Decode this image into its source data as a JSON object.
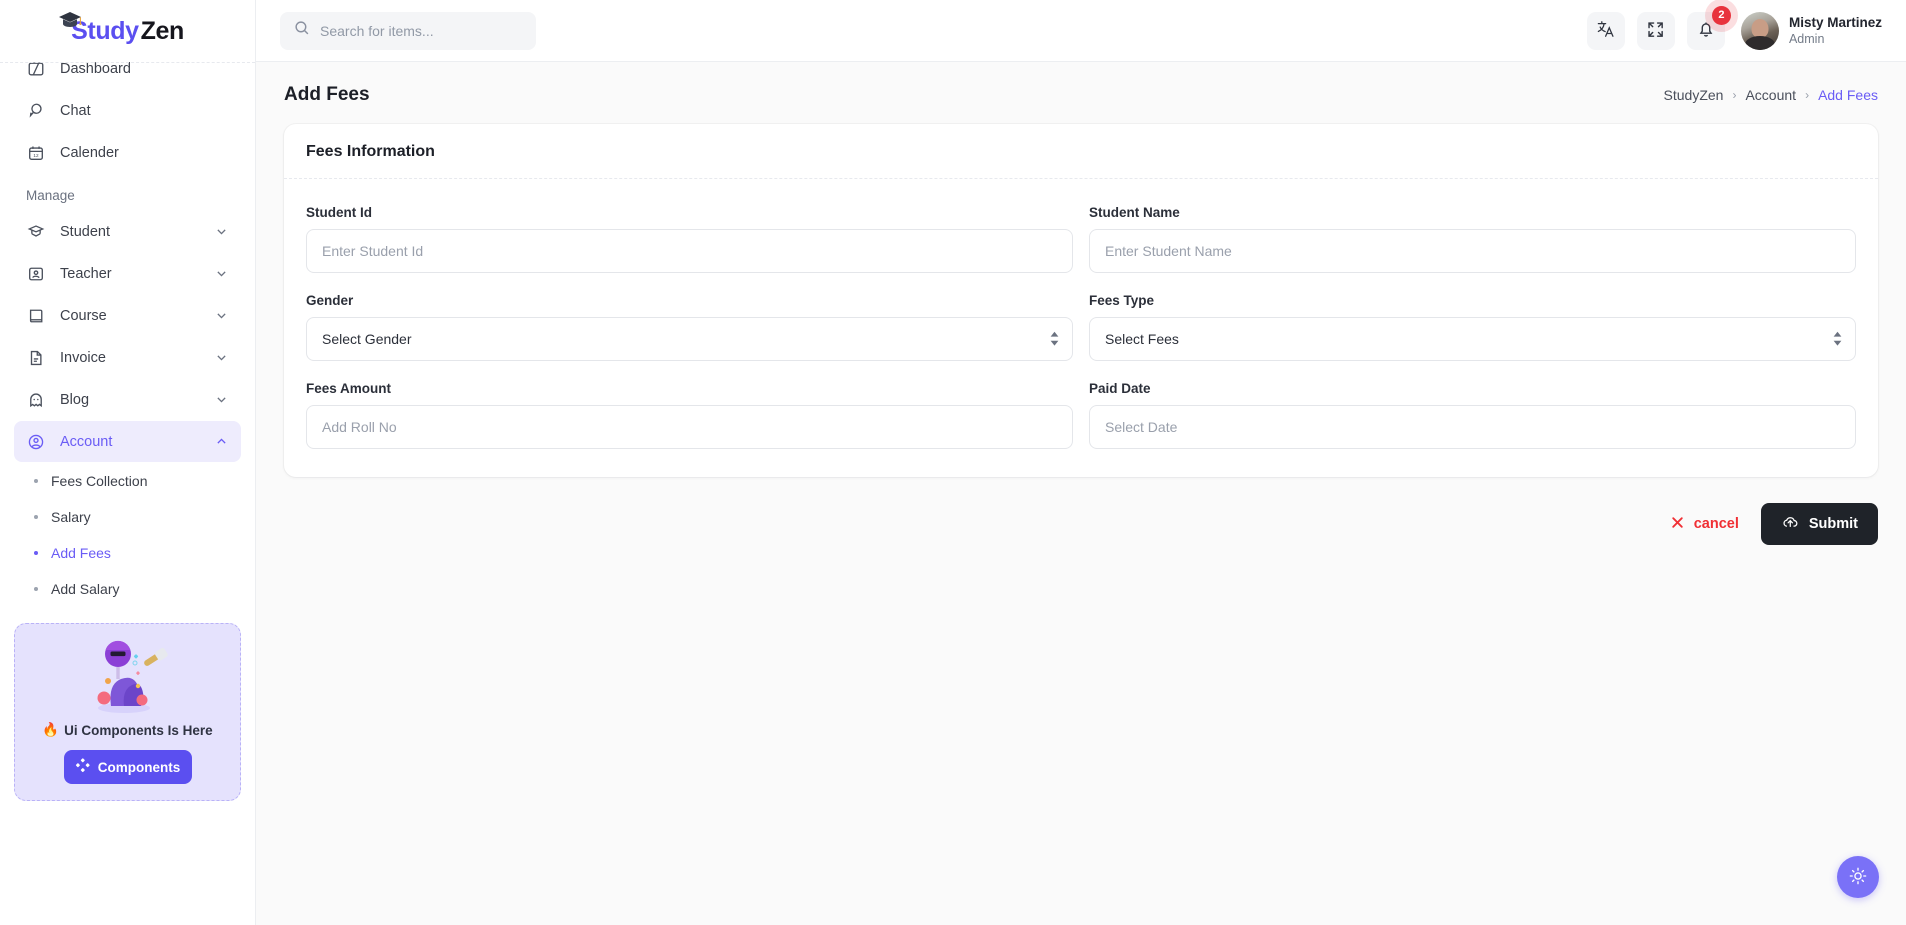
{
  "brand": {
    "part1": "Study",
    "part2": "Zen",
    "cap_icon": "graduation-cap-icon"
  },
  "sidebar": {
    "top_items": [
      {
        "label": "Dashboard",
        "icon": "dashboard-icon"
      },
      {
        "label": "Chat",
        "icon": "chat-icon"
      },
      {
        "label": "Calender",
        "icon": "calendar-icon"
      }
    ],
    "section_label": "Manage",
    "manage_items": [
      {
        "label": "Student",
        "icon": "student-cap-icon",
        "expanded": false
      },
      {
        "label": "Teacher",
        "icon": "teacher-icon",
        "expanded": false
      },
      {
        "label": "Course",
        "icon": "book-icon",
        "expanded": false
      },
      {
        "label": "Invoice",
        "icon": "invoice-file-icon",
        "expanded": false
      },
      {
        "label": "Blog",
        "icon": "ghost-icon",
        "expanded": false
      },
      {
        "label": "Account",
        "icon": "account-circle-icon",
        "expanded": true,
        "active": true
      }
    ],
    "sub_items": [
      {
        "label": "Fees Collection",
        "active": false
      },
      {
        "label": "Salary",
        "active": false
      },
      {
        "label": "Add Fees",
        "active": true
      },
      {
        "label": "Add Salary",
        "active": false
      }
    ],
    "promo": {
      "fire_emoji": "🔥",
      "text": "Ui Components Is Here",
      "button_label": "Components",
      "button_icon": "diamond-grid-icon",
      "art_icon": "ui-components-illustration"
    }
  },
  "topbar": {
    "search": {
      "placeholder": "Search for items...",
      "value": "",
      "icon": "search-icon"
    },
    "translate_icon": "translate-icon",
    "fullscreen_icon": "fullscreen-expand-icon",
    "notifications": {
      "icon": "bell-icon",
      "count": "2"
    },
    "user": {
      "name": "Misty Martinez",
      "role": "Admin",
      "avatar": "user-avatar"
    }
  },
  "page": {
    "title": "Add Fees",
    "breadcrumb": [
      {
        "label": "StudyZen",
        "current": false
      },
      {
        "label": "Account",
        "current": false
      },
      {
        "label": "Add Fees",
        "current": true
      }
    ],
    "separator": "›"
  },
  "card": {
    "title": "Fees Information",
    "fields": {
      "student_id": {
        "label": "Student Id",
        "placeholder": "Enter Student Id",
        "value": ""
      },
      "student_name": {
        "label": "Student Name",
        "placeholder": "Enter Student Name",
        "value": ""
      },
      "gender": {
        "label": "Gender",
        "selected": "Select Gender"
      },
      "fees_type": {
        "label": "Fees Type",
        "selected": "Select Fees"
      },
      "fees_amount": {
        "label": "Fees Amount",
        "placeholder": "Add Roll No",
        "value": ""
      },
      "paid_date": {
        "label": "Paid Date",
        "placeholder": "Select Date",
        "value": ""
      }
    }
  },
  "actions": {
    "cancel_label": "cancel",
    "cancel_icon": "close-x-icon",
    "submit_label": "Submit",
    "submit_icon": "cloud-upload-icon"
  },
  "fab": {
    "icon": "brightness-sun-icon"
  },
  "colors": {
    "accent": "#6a5cf5",
    "accent_soft": "#eeecfd",
    "danger": "#f02f34",
    "dark": "#1f2329",
    "badge": "#e8333d"
  }
}
